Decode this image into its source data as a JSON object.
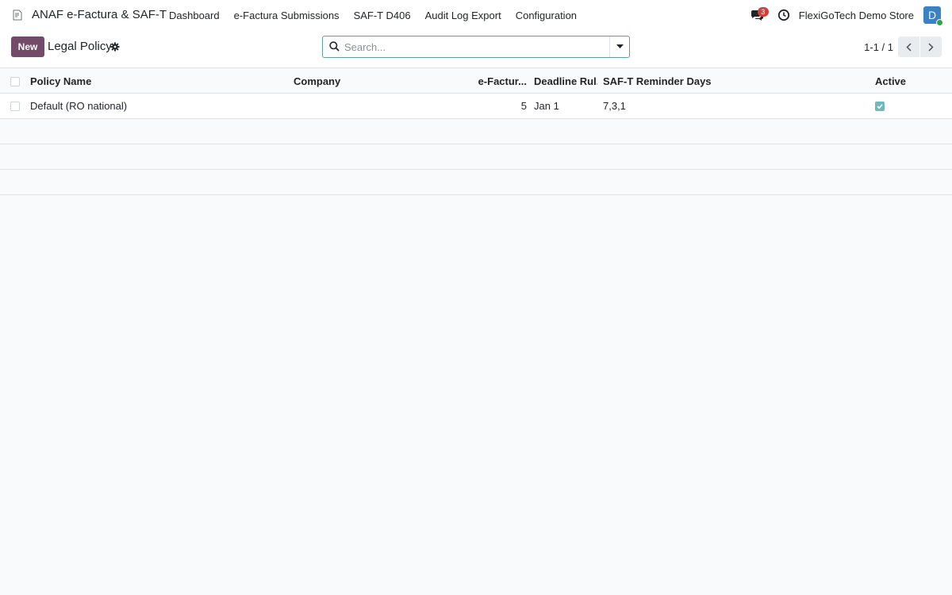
{
  "navbar": {
    "app_name": "ANAF e-Factura & SAF-T",
    "menu": [
      "Dashboard",
      "e-Factura Submissions",
      "SAF-T D406",
      "Audit Log Export",
      "Configuration"
    ],
    "messages_count": "3",
    "company": "FlexiGoTech Demo Store",
    "avatar_letter": "D"
  },
  "control": {
    "new_label": "New",
    "title": "Legal Policy",
    "search_placeholder": "Search...",
    "pager": "1-1 / 1"
  },
  "table": {
    "columns": [
      "Policy Name",
      "Company",
      "e-Factur...",
      "Deadline Rul...",
      "SAF-T Reminder Days",
      "Active"
    ],
    "rows": [
      {
        "policy_name": "Default (RO national)",
        "company": "",
        "efactura": "5",
        "deadline": "Jan 1",
        "saft_days": "7,3,1",
        "active": true
      }
    ]
  },
  "colors": {
    "primary": "#714b67",
    "accent": "#5f9ea0",
    "badge": "#d23f3a",
    "avatar": "#3a82c4",
    "online": "#28a745"
  }
}
